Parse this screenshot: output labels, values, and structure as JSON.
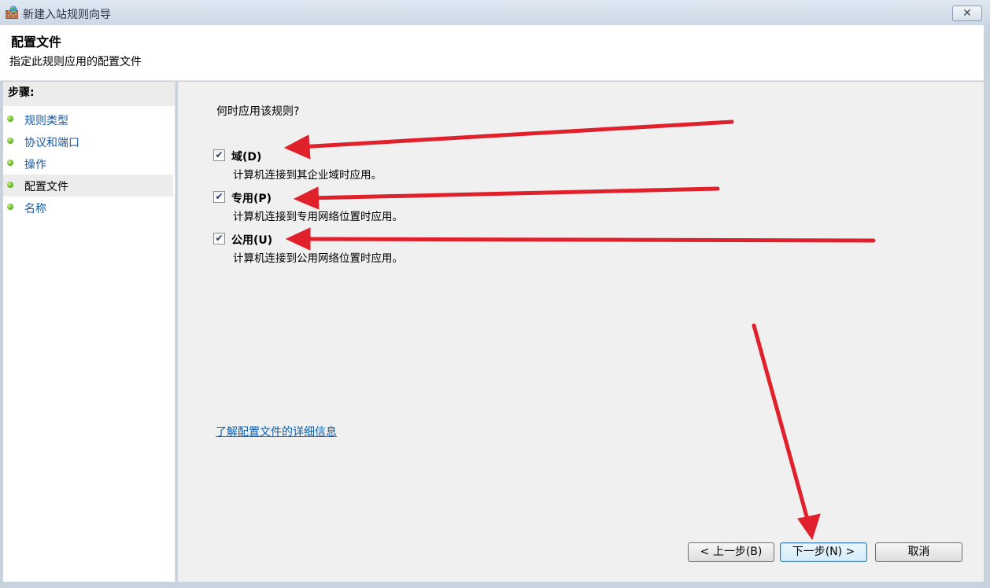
{
  "window": {
    "title": "新建入站规则向导",
    "close_label": "✕"
  },
  "header": {
    "title": "配置文件",
    "subtitle": "指定此规则应用的配置文件"
  },
  "sidebar": {
    "title": "步骤:",
    "items": [
      {
        "label": "规则类型",
        "current": false
      },
      {
        "label": "协议和端口",
        "current": false
      },
      {
        "label": "操作",
        "current": false
      },
      {
        "label": "配置文件",
        "current": true
      },
      {
        "label": "名称",
        "current": false
      }
    ]
  },
  "main": {
    "question": "何时应用该规则?",
    "options": [
      {
        "label": "域(D)",
        "description": "计算机连接到其企业域时应用。",
        "checked": true
      },
      {
        "label": "专用(P)",
        "description": "计算机连接到专用网络位置时应用。",
        "checked": true
      },
      {
        "label": "公用(U)",
        "description": "计算机连接到公用网络位置时应用。",
        "checked": true
      }
    ],
    "link": "了解配置文件的详细信息"
  },
  "buttons": {
    "back": "< 上一步(B)",
    "next": "下一步(N) >",
    "cancel": "取消"
  },
  "colors": {
    "annotation_arrow": "#e0202a",
    "link": "#0b5fb0",
    "step_dot": "#4fae1c"
  }
}
